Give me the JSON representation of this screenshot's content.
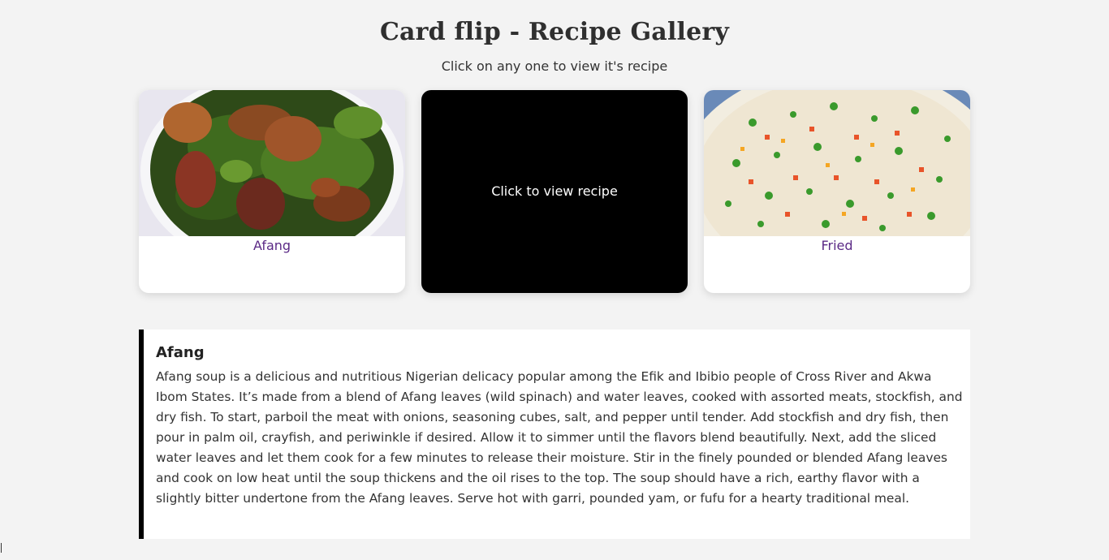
{
  "header": {
    "title": "Card flip - Recipe Gallery",
    "subtitle": "Click on any one to view it's recipe"
  },
  "cards": [
    {
      "label": "Afang",
      "image": "afang-soup-photo"
    },
    {
      "back_text": "Click to view recipe"
    },
    {
      "label": "Fried",
      "image": "fried-rice-photo"
    }
  ],
  "recipe": {
    "title": "Afang",
    "body": "Afang soup is a delicious and nutritious Nigerian delicacy popular among the Efik and Ibibio people of Cross River and Akwa Ibom States. It’s made from a blend of Afang leaves (wild spinach) and water leaves, cooked with assorted meats, stockfish, and dry fish. To start, parboil the meat with onions, seasoning cubes, salt, and pepper until tender. Add stockfish and dry fish, then pour in palm oil, crayfish, and periwinkle if desired. Allow it to simmer until the flavors blend beautifully. Next, add the sliced water leaves and let them cook for a few minutes to release their moisture. Stir in the finely pounded or blended Afang leaves and cook on low heat until the soup thickens and the oil rises to the top. The soup should have a rich, earthy flavor with a slightly bitter undertone from the Afang leaves. Serve hot with garri, pounded yam, or fufu for a hearty traditional meal."
  },
  "colors": {
    "background": "#f3f3f3",
    "card_label": "#5b2a86",
    "card_back": "#000000",
    "recipe_border": "#000000"
  }
}
